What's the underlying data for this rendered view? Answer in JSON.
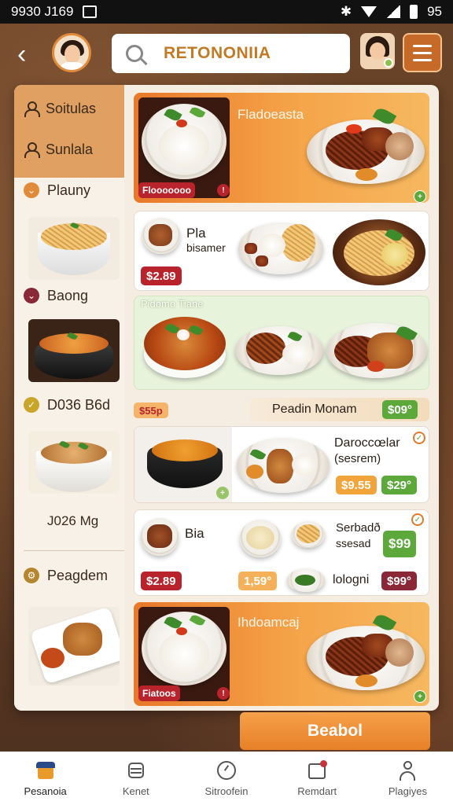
{
  "status_bar": {
    "time": "9930 J169",
    "right_text": "95"
  },
  "header": {
    "search_text": "RETONONIIA"
  },
  "sidebar": {
    "items": [
      {
        "label": "Soitulas",
        "icon": "person-icon"
      },
      {
        "label": "Sunlala",
        "icon": "person-icon"
      },
      {
        "label": "Plauny",
        "icon": "chevron-icon"
      },
      {
        "label": "Baong",
        "icon": "chevron-icon"
      },
      {
        "label": "D036 B6d",
        "icon": "check-icon"
      },
      {
        "label": "J026 Mg",
        "icon": ""
      },
      {
        "label": "Peagdem",
        "icon": "gear-icon"
      }
    ]
  },
  "cards": {
    "card1": {
      "title": "Fladoeasta",
      "badge": "Flooooooo"
    },
    "card2": {
      "title": "Pla",
      "subtitle": "bisamer",
      "price": "$2.89"
    },
    "card3": {
      "title": "Pidomo Tiane"
    },
    "promo": {
      "price": "$55p",
      "label": "Peadin Monam",
      "price2": "$09°"
    },
    "card4": {
      "title": "Daroccœlar",
      "subtitle": "(sesrem)",
      "price1": "$9.55",
      "price2": "$29°"
    },
    "card5": {
      "title": "Bia",
      "price": "$2.89",
      "title2": "Serbadð",
      "subtitle2": "ssesad",
      "price2": "$99",
      "price3": "1,59°",
      "label": "lologni",
      "price4": "$99°"
    },
    "card6": {
      "title": "Ihdoamcaj",
      "badge": "Fiatoos"
    }
  },
  "order_button": "Beabol",
  "tabs": [
    {
      "label": "Pesanoia",
      "icon": "home-icon"
    },
    {
      "label": "Kenet",
      "icon": "burger-icon"
    },
    {
      "label": "Sitroofein",
      "icon": "clock-icon"
    },
    {
      "label": "Remdart",
      "icon": "cart-icon"
    },
    {
      "label": "Plagiyes",
      "icon": "profile-icon"
    }
  ],
  "colors": {
    "accent": "#e8782a",
    "brand_text": "#c47a24",
    "price_red": "#b8232c",
    "price_green": "#5ca83a"
  }
}
